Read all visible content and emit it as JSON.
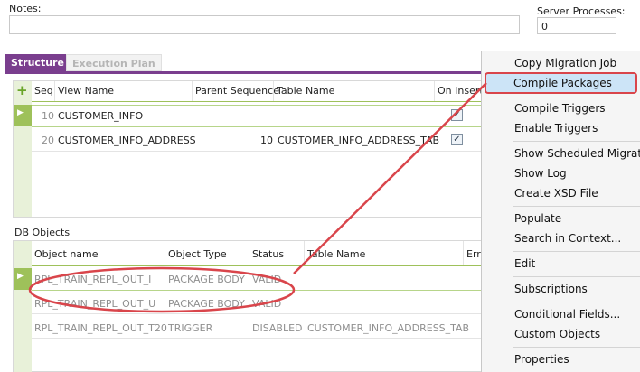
{
  "notes": {
    "label": "Notes:",
    "value": ""
  },
  "server_processes": {
    "label": "Server Processes:",
    "value": "0"
  },
  "tabs": [
    {
      "label": "Structure",
      "active": true
    },
    {
      "label": "Execution Plan",
      "active": false
    }
  ],
  "structure": {
    "add_glyph": "+",
    "columns": [
      "Seq",
      "View Name",
      "Parent Sequence",
      "Table Name",
      "On Insert"
    ],
    "rows": [
      {
        "seq": "10",
        "view_name": "CUSTOMER_INFO",
        "parent_sequence": "",
        "table_name": "",
        "on_insert": true,
        "selected": true
      },
      {
        "seq": "20",
        "view_name": "CUSTOMER_INFO_ADDRESS",
        "parent_sequence": "10",
        "table_name": "CUSTOMER_INFO_ADDRESS_TAB",
        "on_insert": true,
        "selected": false
      }
    ]
  },
  "db_objects": {
    "label": "DB Objects",
    "columns": [
      "Object name",
      "Object Type",
      "Status",
      "Table Name",
      "Err"
    ],
    "rows": [
      {
        "object_name": "RPL_TRAIN_REPL_OUT_I",
        "object_type": "PACKAGE BODY",
        "status": "VALID",
        "table_name": "",
        "selected": true
      },
      {
        "object_name": "RPL_TRAIN_REPL_OUT_U",
        "object_type": "PACKAGE BODY",
        "status": "VALID",
        "table_name": "",
        "selected": false
      },
      {
        "object_name": "RPL_TRAIN_REPL_OUT_T20",
        "object_type": "TRIGGER",
        "status": "DISABLED",
        "table_name": "CUSTOMER_INFO_ADDRESS_TAB",
        "selected": false
      }
    ]
  },
  "context_menu": {
    "items": [
      "Copy Migration Job",
      "Compile Packages",
      "Compile Triggers",
      "Enable Triggers",
      "Show Scheduled Migratio",
      "Show Log",
      "Create XSD File",
      "Populate",
      "Search in Context...",
      "Edit",
      "Subscriptions",
      "Conditional Fields...",
      "Custom Objects",
      "Properties"
    ],
    "highlighted": "Compile Packages"
  },
  "colors": {
    "accent": "#7a3e8e",
    "selection_green": "#9ec15a",
    "annotation_red": "#d9454b",
    "menu_highlight": "#cce4f7"
  }
}
